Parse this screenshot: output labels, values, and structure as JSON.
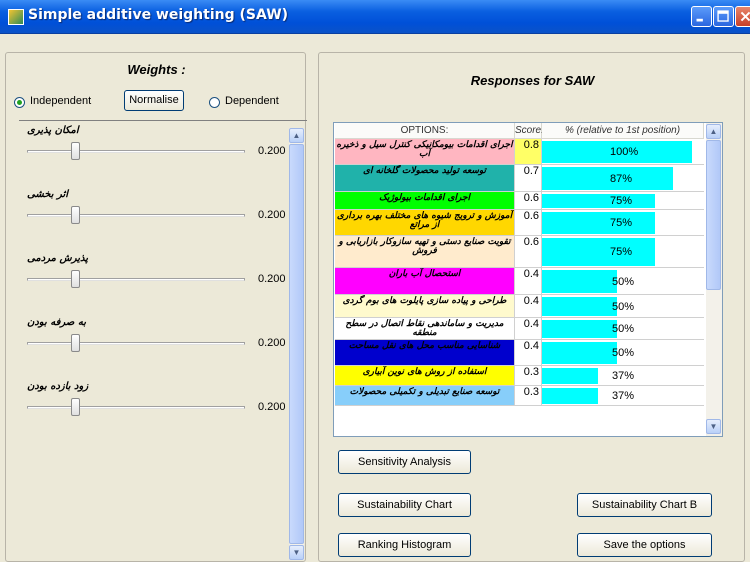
{
  "window": {
    "title": "Simple additive weighting (SAW)",
    "icon": "app-icon",
    "controls": [
      "minimize-icon",
      "maximize-icon",
      "close-icon"
    ]
  },
  "weights": {
    "title": "Weights :",
    "independent_label": "Independent",
    "independent_selected": true,
    "normalise_label": "Normalise",
    "dependent_label": "Dependent",
    "criteria": [
      {
        "label": "امکان پذیری",
        "value_text": "0.200",
        "level": 0.2
      },
      {
        "label": "اثر بخشی",
        "value_text": "0.200",
        "level": 0.2
      },
      {
        "label": "پذیرش مردمی",
        "value_text": "0.200",
        "level": 0.2
      },
      {
        "label": "به صرفه بودن",
        "value_text": "0.200",
        "level": 0.2
      },
      {
        "label": "زود بازده بودن",
        "value_text": "0.200",
        "level": 0.2
      }
    ]
  },
  "responses": {
    "title": "Responses for SAW",
    "columns": [
      "OPTIONS:",
      "Score:",
      "% (relative to 1st position)"
    ],
    "rows": [
      {
        "option": "اجرای اقدامات بیومکانیکی کنترل سیل و ذخیره آب",
        "score": "0.8",
        "percent_text": "100%",
        "percent": 100,
        "color": "#ffb6c1"
      },
      {
        "option": "توسعه تولید محصولات گلخانه ای",
        "score": "0.7",
        "percent_text": "87%",
        "percent": 87,
        "color": "#20b2aa"
      },
      {
        "option": "اجرای اقدامات بیولوژیک",
        "score": "0.6",
        "percent_text": "75%",
        "percent": 75,
        "color": "#00ff00"
      },
      {
        "option": "آموزش و ترویج شیوه های مختلف بهره برداری از مراتع",
        "score": "0.6",
        "percent_text": "75%",
        "percent": 75,
        "color": "#ffd700"
      },
      {
        "option": "تقویت صنایع دستی و تهیه سازوکار بازاریابی و فروش",
        "score": "0.6",
        "percent_text": "75%",
        "percent": 75,
        "color": "#ffebcd"
      },
      {
        "option": "استحصال آب باران",
        "score": "0.4",
        "percent_text": "50%",
        "percent": 50,
        "color": "#ff00ff"
      },
      {
        "option": "طراحی و پیاده سازی پایلوت های بوم گردی",
        "score": "0.4",
        "percent_text": "50%",
        "percent": 50,
        "color": "#fffacd"
      },
      {
        "option": "مدیریت و ساماندهی نقاط اتصال در سطح منطقه",
        "score": "0.4",
        "percent_text": "50%",
        "percent": 50,
        "color": "#ffffff"
      },
      {
        "option": "شناسایی مناسب محل های نقل مساحت",
        "score": "0.4",
        "percent_text": "50%",
        "percent": 50,
        "color": "#0000cd"
      },
      {
        "option": "استفاده از روش های نوین آبیاری",
        "score": "0.3",
        "percent_text": "37%",
        "percent": 37,
        "color": "#ffff00"
      },
      {
        "option": "توسعه صنایع تبدیلی و تکمیلی محصولات",
        "score": "0.3",
        "percent_text": "37%",
        "percent": 37,
        "color": "#87cefa"
      }
    ]
  },
  "buttons": {
    "sensitivity": "Sensitivity Analysis",
    "sustainability": "Sustainability Chart",
    "sustainability_b": "Sustainability Chart B",
    "ranking": "Ranking Histogram",
    "save": "Save the options"
  }
}
